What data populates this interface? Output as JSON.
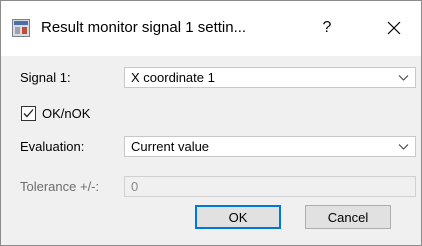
{
  "window": {
    "title": "Result monitor signal 1 settin...",
    "help_label": "?",
    "icon": "settings-app-icon"
  },
  "form": {
    "signal_label": "Signal 1:",
    "signal_value": "X coordinate 1",
    "ok_nok_label": "OK/nOK",
    "ok_nok_checked": true,
    "evaluation_label": "Evaluation:",
    "evaluation_value": "Current value",
    "tolerance_label": "Tolerance +/-:",
    "tolerance_value": "0"
  },
  "buttons": {
    "ok_label": "OK",
    "cancel_label": "Cancel"
  },
  "colors": {
    "accent": "#0078d7",
    "dialog_bg": "#f0f0f0",
    "title_bg": "#ffffff"
  }
}
